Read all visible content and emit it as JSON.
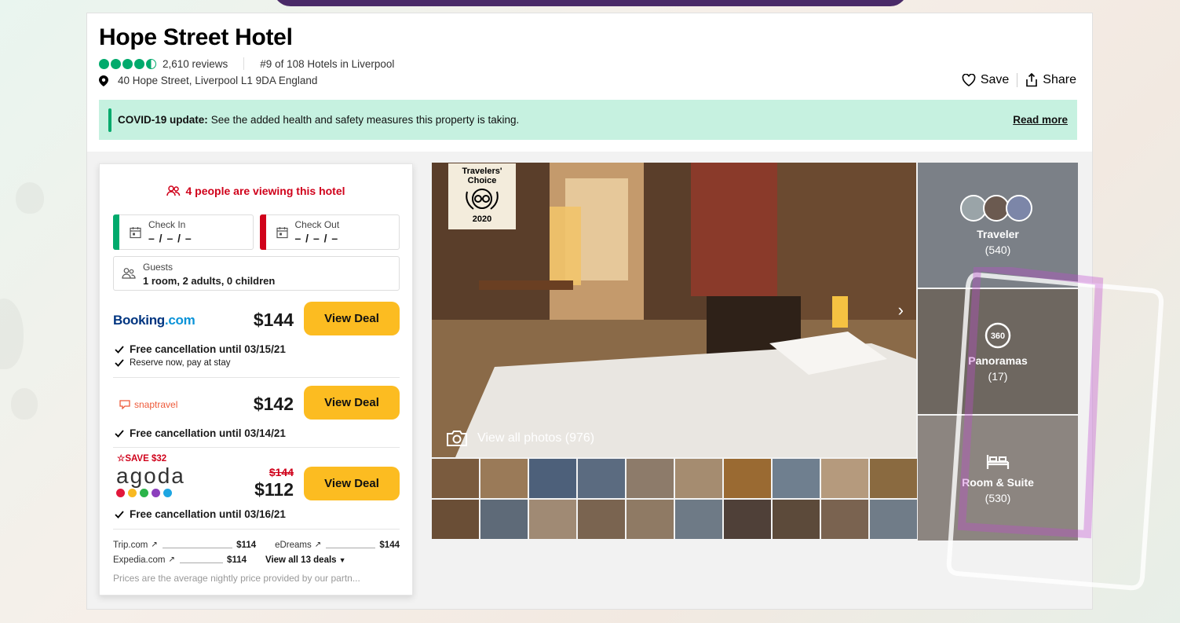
{
  "hotel": {
    "name": "Hope Street Hotel",
    "reviews": "2,610 reviews",
    "ranking": "#9 of 108 Hotels in Liverpool",
    "address": "40 Hope Street, Liverpool L1 9DA England",
    "rating_bubbles": 4.5
  },
  "actions": {
    "save": "Save",
    "share": "Share"
  },
  "covid": {
    "title": "COVID-19 update:",
    "text": "See the added health and safety measures this property is taking.",
    "read_more": "Read more"
  },
  "booking_panel": {
    "viewing": "4 people are viewing this hotel",
    "check_in": {
      "label": "Check In",
      "value": "– / – / –"
    },
    "check_out": {
      "label": "Check Out",
      "value": "– / – / –"
    },
    "guests": {
      "label": "Guests",
      "value": "1 room, 2 adults, 0 children"
    },
    "deals": [
      {
        "provider": "Booking.com",
        "price": "$144",
        "button": "View Deal",
        "perk1": "Free cancellation until 03/15/21",
        "perk2": "Reserve now, pay at stay"
      },
      {
        "provider": "snaptravel",
        "price": "$142",
        "button": "View Deal",
        "perk1": "Free cancellation until 03/14/21"
      },
      {
        "provider": "agoda",
        "save_tag": "SAVE $32",
        "old_price": "$144",
        "price": "$112",
        "button": "View Deal",
        "perk1": "Free cancellation until 03/16/21"
      }
    ],
    "other_deals": [
      {
        "name": "Trip.com",
        "price": "$114"
      },
      {
        "name": "eDreams",
        "price": "$144"
      },
      {
        "name": "Expedia.com",
        "price": "$114"
      }
    ],
    "view_all": "View all 13 deals",
    "disclaimer": "Prices are the average nightly price provided by our partn..."
  },
  "gallery": {
    "badge_line1": "Travelers'",
    "badge_line2": "Choice",
    "badge_year": "2020",
    "view_all_photos": "View all photos (976)",
    "tiles": [
      {
        "label": "Traveler",
        "count": "(540)"
      },
      {
        "label": "Panoramas",
        "count": "(17)"
      },
      {
        "label": "Room & Suite",
        "count": "(530)"
      }
    ]
  },
  "colors": {
    "accent_green": "#00aa6c",
    "deal_button": "#fcbc21",
    "alert_red": "#d0021b",
    "covid_bg": "#c6f1e0"
  }
}
